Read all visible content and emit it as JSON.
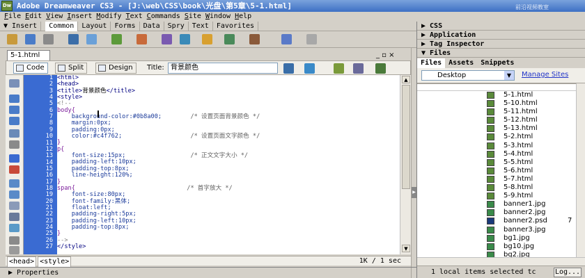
{
  "app": {
    "title": "Adobe Dreamweaver CS3 - [J:\\web\\CSS\\book\\光盘\\第5章\\5-1.html]",
    "watermark": "前沿视频教室",
    "watermark_url": "www.artech.cn"
  },
  "menu": [
    "File",
    "Edit",
    "View",
    "Insert",
    "Modify",
    "Text",
    "Commands",
    "Site",
    "Window",
    "Help"
  ],
  "insert_bar": {
    "label": "▼ Insert",
    "tabs": [
      "Common",
      "Layout",
      "Forms",
      "Data",
      "Spry",
      "Text",
      "Favorites"
    ],
    "active_tab": "Common"
  },
  "document": {
    "tab": "5-1.html",
    "controls": "_ ▫ ×",
    "views": {
      "code": "Code",
      "split": "Split",
      "design": "Design"
    },
    "title_label": "Title:",
    "title_value": "背景颜色",
    "code_lines": [
      {
        "n": "1",
        "html": "<span class='tag'>&lt;html&gt;</span>"
      },
      {
        "n": "2",
        "html": "<span class='tag'>&lt;head&gt;</span>"
      },
      {
        "n": "3",
        "html": "<span class='tag'>&lt;title&gt;</span>背景颜色<span class='tag'>&lt;/title&gt;</span>"
      },
      {
        "n": "4",
        "html": "<span class='tag'>&lt;style&gt;</span>"
      },
      {
        "n": "5",
        "html": "<span class='gray'>&lt;!--</span>"
      },
      {
        "n": "6",
        "html": "<span class='sel'>body{</span>"
      },
      {
        "n": "7",
        "html": "    <span class='prop'>background-color:#0b8a00;</span>        <span class='com'>/* 设置页面背景颜色 */</span>"
      },
      {
        "n": "8",
        "html": "    <span class='prop'>margin:0px;</span>"
      },
      {
        "n": "9",
        "html": "    <span class='prop'>padding:0px;</span>"
      },
      {
        "n": "10",
        "html": "    <span class='prop'>color:#c4f762;</span>                   <span class='com'>/* 设置页面文字颜色 */</span>"
      },
      {
        "n": "11",
        "html": "<span class='sel'>}</span>"
      },
      {
        "n": "12",
        "html": "<span class='sel'>p{</span>"
      },
      {
        "n": "13",
        "html": "    <span class='prop'>font-size:15px;</span>                  <span class='com'>/* 正文文字大小 */</span>"
      },
      {
        "n": "14",
        "html": "    <span class='prop'>padding-left:10px;</span>"
      },
      {
        "n": "15",
        "html": "    <span class='prop'>padding-top:8px;</span>"
      },
      {
        "n": "16",
        "html": "    <span class='prop'>line-height:120%;</span>"
      },
      {
        "n": "17",
        "html": "<span class='sel'>}</span>"
      },
      {
        "n": "18",
        "html": "<span class='sel'>span{</span>                               <span class='com'>/* 首字放大 */</span>"
      },
      {
        "n": "19",
        "html": "    <span class='prop'>font-size:80px;</span>"
      },
      {
        "n": "20",
        "html": "    <span class='prop'>font-family:黑体;</span>"
      },
      {
        "n": "21",
        "html": "    <span class='prop'>float:left;</span>"
      },
      {
        "n": "22",
        "html": "    <span class='prop'>padding-right:5px;</span>"
      },
      {
        "n": "23",
        "html": "    <span class='prop'>padding-left:10px;</span>"
      },
      {
        "n": "24",
        "html": "    <span class='prop'>padding-top:8px;</span>"
      },
      {
        "n": "25",
        "html": "<span class='sel'>}</span>"
      },
      {
        "n": "26",
        "html": "<span class='gray'>--&gt;</span>"
      },
      {
        "n": "27",
        "html": "<span class='tag'>&lt;/style&gt;</span>"
      }
    ],
    "status_tags": [
      "<head>",
      "<style>"
    ],
    "status_info": "1K / 1 sec"
  },
  "properties_panel": "▶ Properties",
  "right_panels": {
    "css": "▶ CSS",
    "application": "▶ Application",
    "tag_inspector": "▶ Tag Inspector",
    "files": "▼ Files",
    "file_tabs": [
      "Files",
      "Assets",
      "Snippets"
    ],
    "site_select": "Desktop",
    "manage_sites": "Manage Sites",
    "files_list": [
      {
        "name": "5-1.html",
        "type": "html",
        "size": ""
      },
      {
        "name": "5-10.html",
        "type": "html",
        "size": ""
      },
      {
        "name": "5-11.html",
        "type": "html",
        "size": ""
      },
      {
        "name": "5-12.html",
        "type": "html",
        "size": ""
      },
      {
        "name": "5-13.html",
        "type": "html",
        "size": ""
      },
      {
        "name": "5-2.html",
        "type": "html",
        "size": ""
      },
      {
        "name": "5-3.html",
        "type": "html",
        "size": ""
      },
      {
        "name": "5-4.html",
        "type": "html",
        "size": ""
      },
      {
        "name": "5-5.html",
        "type": "html",
        "size": ""
      },
      {
        "name": "5-6.html",
        "type": "html",
        "size": ""
      },
      {
        "name": "5-7.html",
        "type": "html",
        "size": ""
      },
      {
        "name": "5-8.html",
        "type": "html",
        "size": ""
      },
      {
        "name": "5-9.html",
        "type": "html",
        "size": ""
      },
      {
        "name": "banner1.jpg",
        "type": "img",
        "size": ""
      },
      {
        "name": "banner2.jpg",
        "type": "img",
        "size": ""
      },
      {
        "name": "banner2.psd",
        "type": "psd",
        "size": "7"
      },
      {
        "name": "banner3.jpg",
        "type": "img",
        "size": ""
      },
      {
        "name": "bg1.jpg",
        "type": "img",
        "size": ""
      },
      {
        "name": "bg10.jpg",
        "type": "img",
        "size": ""
      },
      {
        "name": "bg2.jpg",
        "type": "img",
        "size": ""
      }
    ],
    "status_text": "1 local items selected tc",
    "log_button": "Log..."
  },
  "colors": {
    "gutter": "#3a6bd2",
    "title_bar": "#3d6fc4",
    "link": "#1f32c8"
  }
}
